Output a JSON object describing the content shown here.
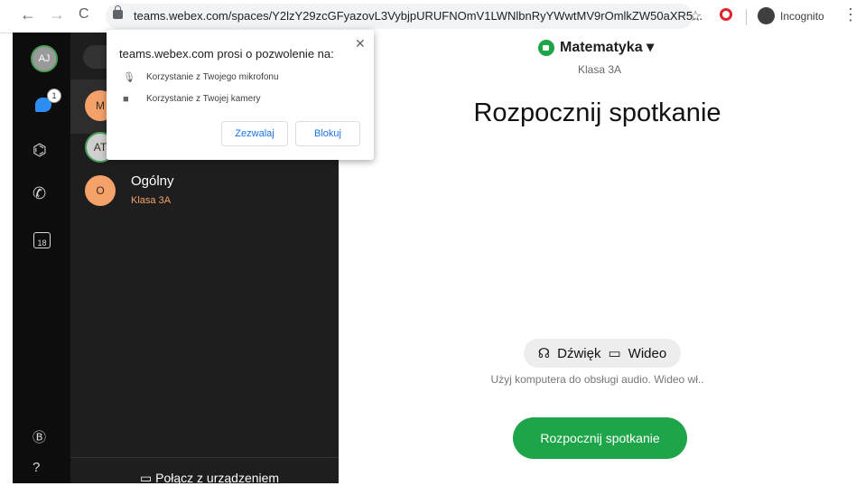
{
  "browser": {
    "url": "teams.webex.com/spaces/Y2lzY29zcGFyazovL3VybjpURUFNOmV1LWNlbnRyYWwtMV9rOmlkZW50aXR5...",
    "incognito_label": "Incognito"
  },
  "rail": {
    "user_initials": "AJ",
    "notification_count": "1",
    "calendar_day": "18"
  },
  "spaces": {
    "rows": [
      {
        "initial": "M",
        "color": "#f4a26a"
      },
      {
        "initial": "AT",
        "color": "#cfcfcf"
      },
      {
        "initial": "O",
        "title": "Ogólny",
        "subtitle": "Klasa 3A",
        "color": "#f4a26a"
      }
    ],
    "connect_label": "Połącz z urządzeniem"
  },
  "main": {
    "space_name": "Matematyka",
    "space_subtitle": "Klasa 3A",
    "heading": "Rozpocznij spotkanie",
    "audio_label": "Dźwięk",
    "video_label": "Wideo",
    "hint": "Użyj komputera do obsługi audio. Wideo wł..",
    "start_button": "Rozpocznij spotkanie"
  },
  "permission_popup": {
    "title": "teams.webex.com prosi o pozwolenie na:",
    "microphone": "Korzystanie z Twojego mikrofonu",
    "camera": "Korzystanie z Twojej kamery",
    "allow": "Zezwalaj",
    "block": "Blokuj"
  },
  "colors": {
    "accent_green": "#1ea54a",
    "rail_bg": "#0d0d0d",
    "list_bg": "#1e1e1e"
  }
}
